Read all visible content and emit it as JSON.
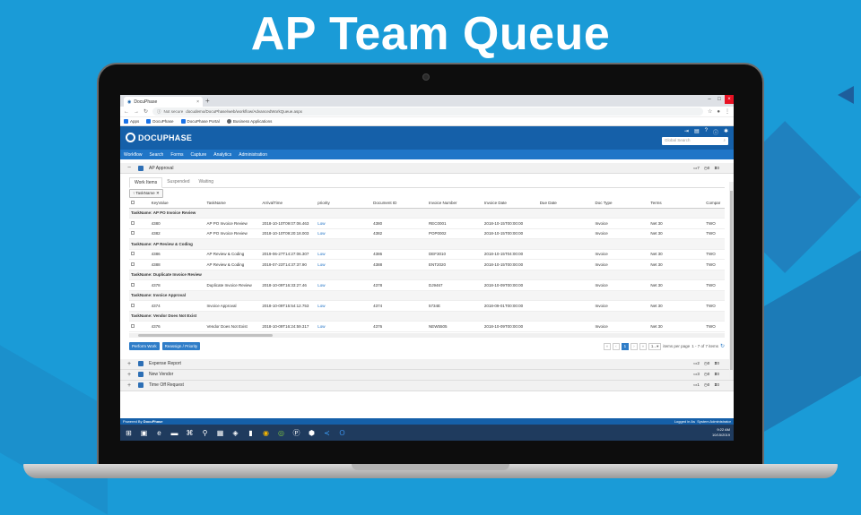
{
  "headline": "AP Team Queue",
  "browser": {
    "tab_title": "DocuPhase",
    "url_security": "Not secure",
    "url": "docudemo/DocuPhase/web/workflow/AdvancedWorkQueue.aspx",
    "bookmarks": [
      "Apps",
      "DocuPhase",
      "DocuPhase Portal",
      "Business Applications"
    ]
  },
  "app": {
    "logo": "DOCUPHASE",
    "search_placeholder": "Global Search",
    "menu": [
      "Workflow",
      "Search",
      "Forms",
      "Capture",
      "Analytics",
      "Administration"
    ]
  },
  "queues": [
    {
      "name": "AP Approval",
      "expanded": true,
      "inbox": "7",
      "pending": "0",
      "hourglass": "0"
    },
    {
      "name": "Expense Report",
      "expanded": false,
      "inbox": "2",
      "pending": "0",
      "hourglass": "0"
    },
    {
      "name": "New Vendor",
      "expanded": false,
      "inbox": "3",
      "pending": "0",
      "hourglass": "0"
    },
    {
      "name": "Time Off Request",
      "expanded": false,
      "inbox": "1",
      "pending": "0",
      "hourglass": "0"
    }
  ],
  "subtabs": [
    "Work Items",
    "Suspended",
    "Waiting"
  ],
  "group_chip": "TaskName",
  "columns": [
    "KeyValue",
    "TaskName",
    "ArrivalTime",
    "priority",
    "Document ID",
    "Invoice Number",
    "Invoice Date",
    "Due Date",
    "Doc Type",
    "Terms",
    "Compar"
  ],
  "groups": [
    {
      "label": "TaskName: AP PO Invoice Review",
      "rows": [
        [
          "4380",
          "AP PO Invoice Review",
          "2018-10-10T09:07:06.463",
          "Low",
          "4380",
          "REC0001",
          "2018-10-15T00:00:00",
          "",
          "Invoice",
          "Net 30",
          "TWO"
        ],
        [
          "4382",
          "AP PO Invoice Review",
          "2018-10-10T09:20:18.003",
          "Low",
          "4382",
          "POP0002",
          "2018-10-15T00:00:00",
          "",
          "Invoice",
          "Net 30",
          "TWO"
        ]
      ]
    },
    {
      "label": "TaskName: AP Review & Coding",
      "rows": [
        [
          "4386",
          "AP Review & Coding",
          "2019-06-27T14:27:06.307",
          "Low",
          "4386",
          "DEF3010",
          "2018-10-15T04:00:00",
          "",
          "Invoice",
          "Net 30",
          "TWO"
        ],
        [
          "4388",
          "AP Review & Coding",
          "2019-07-23T14:37:37.90",
          "Low",
          "4388",
          "ENT2020",
          "2018-10-15T00:00:00",
          "",
          "Invoice",
          "Net 30",
          "TWO"
        ]
      ]
    },
    {
      "label": "TaskName: Duplicate Invoice Review",
      "rows": [
        [
          "4378",
          "Duplicate Invoice Review",
          "2018-10-09T16:33:27.46",
          "Low",
          "4378",
          "DJ9467",
          "2018-10-09T00:00:00",
          "",
          "Invoice",
          "Net 30",
          "TWO"
        ]
      ]
    },
    {
      "label": "TaskName: Invoice Approval",
      "rows": [
        [
          "4374",
          "Invoice Approval",
          "2018-10-09T15:54:12.753",
          "Low",
          "4374",
          "5734E",
          "2018-09-01T00:00:00",
          "",
          "Invoice",
          "Net 30",
          "TWO"
        ]
      ]
    },
    {
      "label": "TaskName: Vendor Does Not Exist",
      "rows": [
        [
          "4376",
          "Vendor Does Not Exist",
          "2018-10-09T16:24:59.317",
          "Low",
          "4376",
          "NEW5505",
          "2018-10-09T00:00:00",
          "",
          "Invoice",
          "Net 30",
          "TWO"
        ]
      ]
    }
  ],
  "buttons": {
    "perform_work": "Perform Work",
    "reassign": "Reassign / Priority"
  },
  "pager": {
    "current": "1",
    "page_size": "1...",
    "per_page_label": "items per page",
    "summary": "1 - 7 of 7 items"
  },
  "footer": {
    "powered_by": "Powered By",
    "brand": "DocuPhase",
    "logged_in": "Logged in As",
    "user": "System Administrator"
  },
  "clock": {
    "time": "9:22 AM",
    "date": "10/15/2019"
  }
}
